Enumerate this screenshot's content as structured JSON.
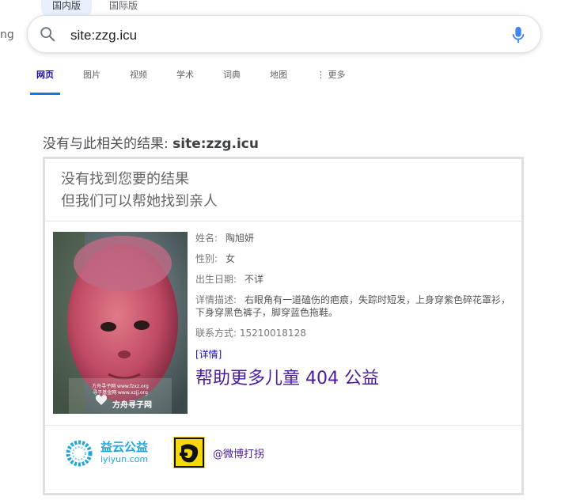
{
  "top_tabs": {
    "domestic": "国内版",
    "international": "国际版"
  },
  "edge_text": "ng",
  "search": {
    "value": "site:zzg.icu"
  },
  "nav": {
    "web": "网页",
    "images": "图片",
    "videos": "视频",
    "academic": "学术",
    "dictionary": "词典",
    "maps": "地图",
    "more": "更多"
  },
  "results": {
    "prefix": "没有与此相关的结果: ",
    "query": "site:zzg.icu"
  },
  "card": {
    "line1": "没有找到您要的结果",
    "line2": "但我们可以帮她找到亲人",
    "name_label": "姓名:",
    "name_value": "陶旭妍",
    "gender_label": "性别:",
    "gender_value": "女",
    "birth_label": "出生日期:",
    "birth_value": "不详",
    "desc_label": "详情描述:",
    "desc_value": "右眼角有一道磕伤的疤痕，失踪时短发，上身穿紫色碎花罩衫，下身穿黑色裤子，脚穿蓝色拖鞋。",
    "contact": "联系方式: 15210018128",
    "detail_link": "[详情]",
    "cta": "帮助更多儿童 404 公益",
    "photo_watermark1": "方舟寻子网 www.fzxz.org",
    "photo_watermark2": "寻子基金网 www.xzjj.org",
    "photo_logo": "方舟寻子网"
  },
  "footer": {
    "yiyun_cn": "益云公益",
    "yiyun_en": "iyiyun.com",
    "weibo_label": "@微博打拐"
  },
  "colors": {
    "link": "#1a0dab",
    "accent": "#1a73e8",
    "cta": "#4b1c9c"
  }
}
